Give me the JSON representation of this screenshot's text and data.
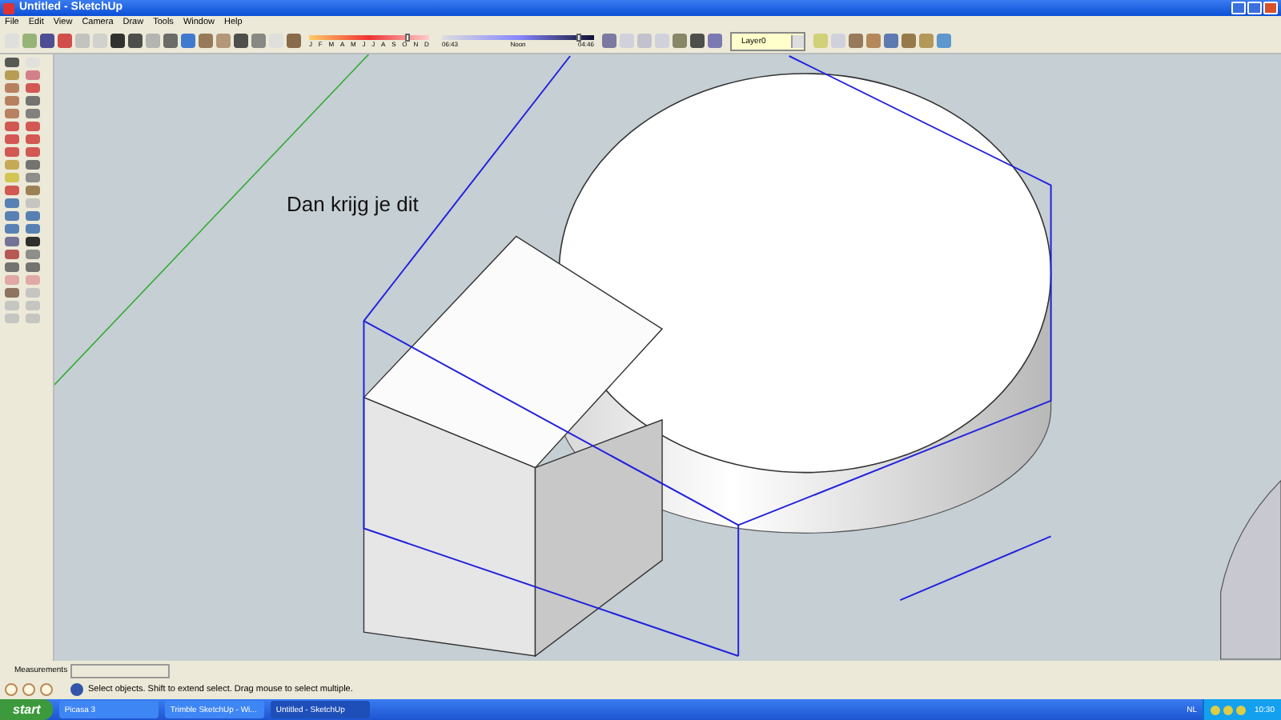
{
  "window": {
    "title": "Untitled - SketchUp"
  },
  "menu": [
    "File",
    "Edit",
    "View",
    "Camera",
    "Draw",
    "Tools",
    "Window",
    "Help"
  ],
  "shadow_settings": {
    "month_slider": {
      "level": 0.82
    },
    "time_slider": {
      "level": 0.9
    },
    "months": [
      "J",
      "F",
      "M",
      "A",
      "M",
      "J",
      "J",
      "A",
      "S",
      "O",
      "N",
      "D"
    ],
    "time_start": "06:43",
    "time_mid": "Noon",
    "time_end": "04:46"
  },
  "layer_dropdown": {
    "value": "Layer0"
  },
  "canvas": {
    "note": "Dan krijg je dit"
  },
  "measurements": {
    "label": "Measurements"
  },
  "status_bar": {
    "text": "Select objects. Shift to extend select. Drag mouse to select multiple."
  },
  "taskbar": {
    "start": "start",
    "tasks": [
      {
        "label": "Picasa 3",
        "selected": false
      },
      {
        "label": "Trimble SketchUp - Wi...",
        "selected": false
      },
      {
        "label": "Untitled - SketchUp",
        "selected": true
      }
    ],
    "language": "NL",
    "clock": "10:30"
  }
}
